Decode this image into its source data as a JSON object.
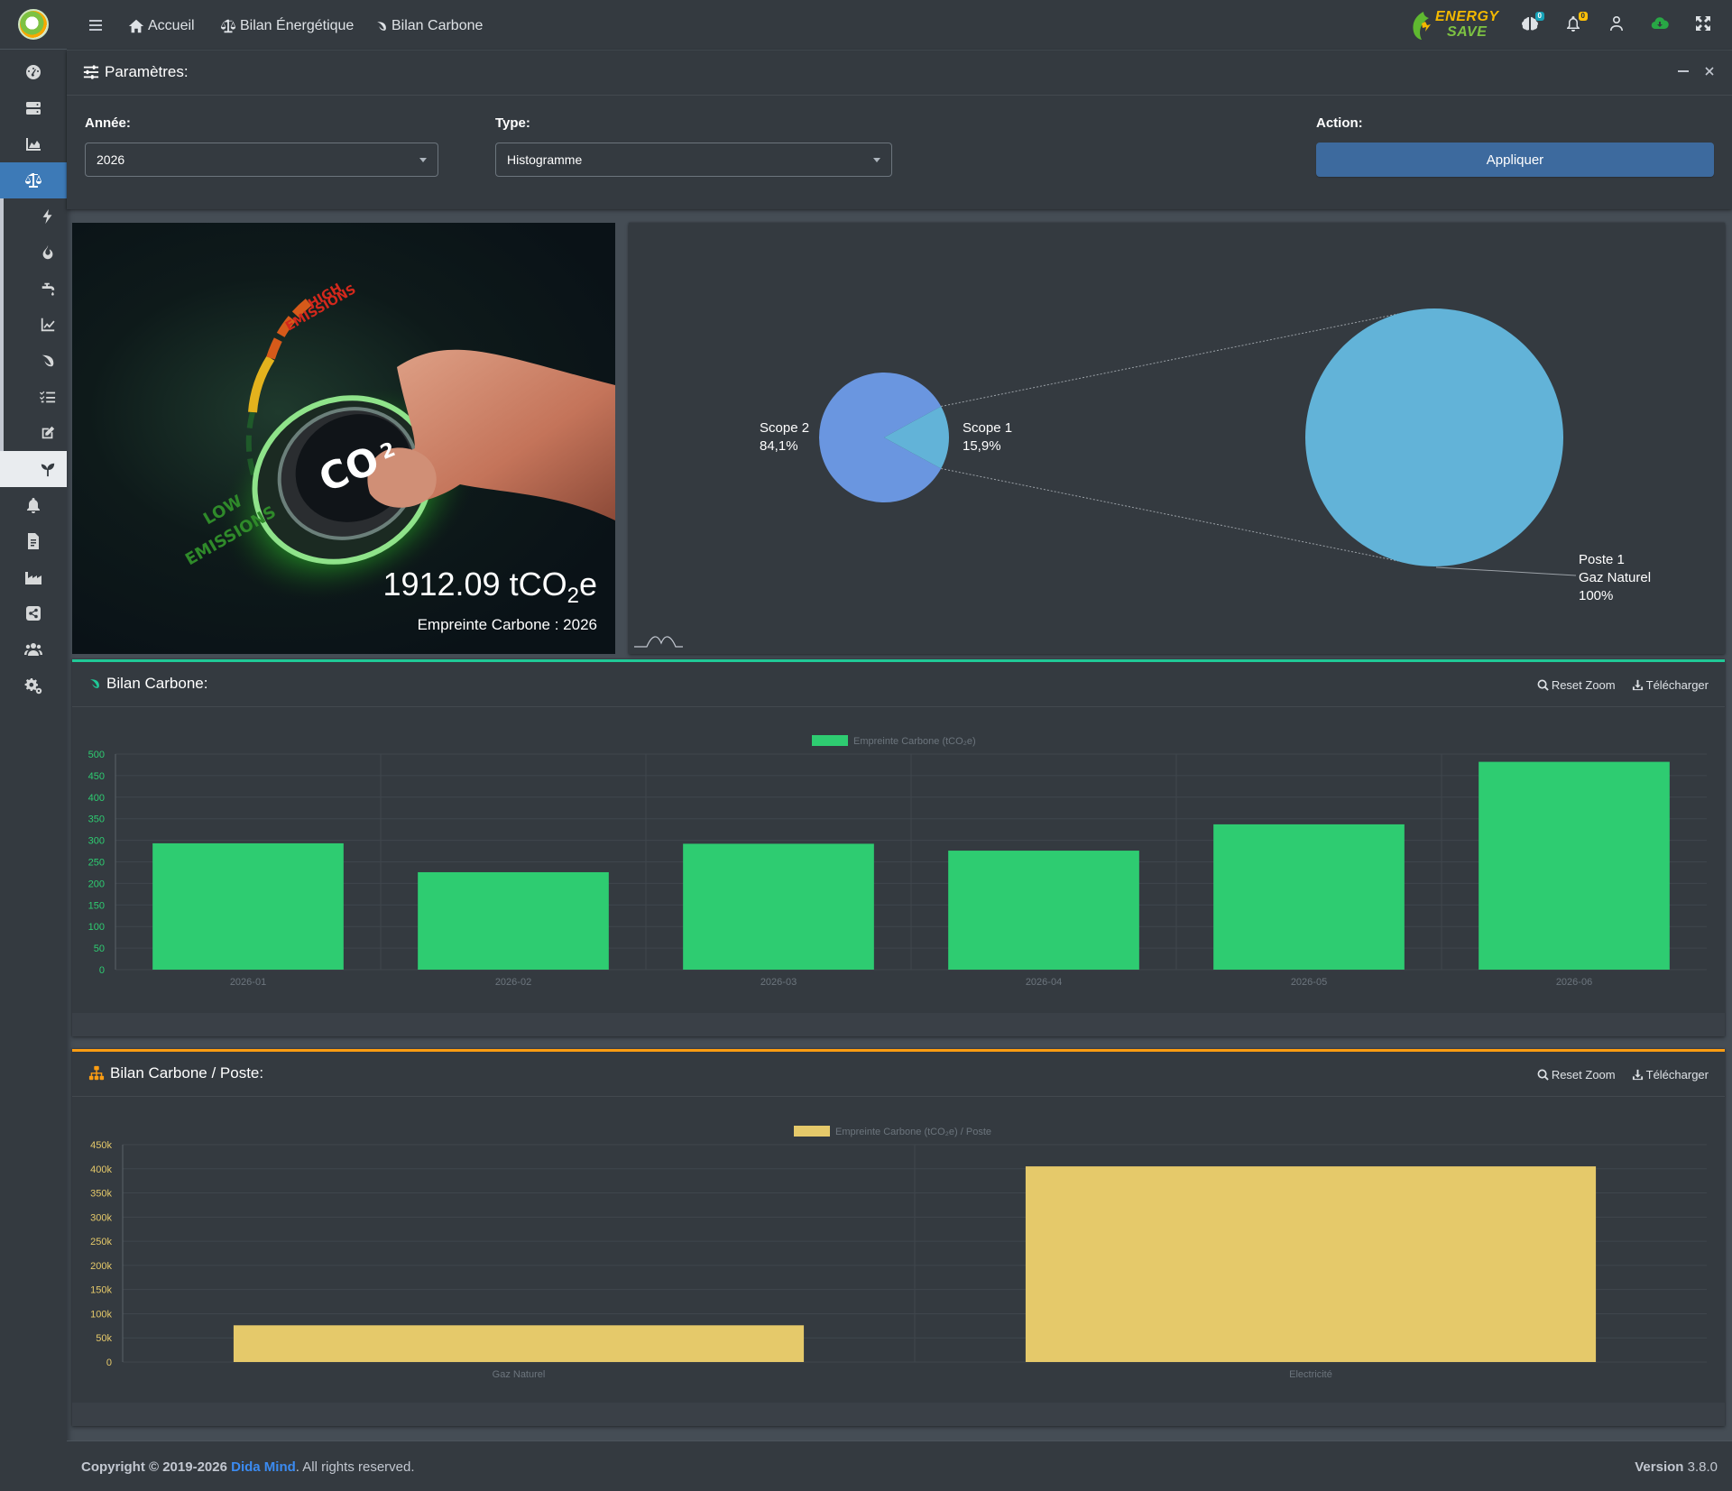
{
  "nav": {
    "home": "Accueil",
    "energy": "Bilan Énergétique",
    "carbon": "Bilan Carbone",
    "brand_line1": "ENERGY",
    "brand_line2": "SAVE",
    "badge_1": "0",
    "badge_2": "0"
  },
  "sidebar": {
    "icons": [
      "dashboard-icon",
      "server-icon",
      "area-chart-icon",
      "balance-scale-icon",
      "bolt-icon",
      "fire-icon",
      "faucet-icon",
      "line-chart-icon",
      "leaf-icon",
      "list-check-icon",
      "edit-icon",
      "seedling-icon",
      "bell-icon",
      "file-invoice-icon",
      "industry-icon",
      "share-icon",
      "users-icon",
      "cogs-icon"
    ]
  },
  "params": {
    "title": "Paramètres:",
    "year_label": "Année:",
    "year_value": "2026",
    "type_label": "Type:",
    "type_value": "Histogramme",
    "action_label": "Action:",
    "apply_label": "Appliquer"
  },
  "hero": {
    "high_line1": "HIGH",
    "high_line2": "EMISSIONS",
    "low_line1": "LOW",
    "low_line2": "EMISSIONS",
    "knob_text": "CO",
    "knob_sub": "2",
    "total_value": "1912.09",
    "unit_main": "tCO",
    "unit_sub": "2",
    "unit_end": "e",
    "caption": "Empreinte Carbone : 2026"
  },
  "pie": {
    "scope2_label": "Scope 2",
    "scope2_pct": "84,1%",
    "scope1_label": "Scope 1",
    "scope1_pct": "15,9%",
    "poste_line1": "Poste 1",
    "poste_line2": "Gaz Naturel",
    "poste_line3": "100%"
  },
  "colors": {
    "scope2": "#6a96e0",
    "scope1": "#62b3d8",
    "bar_green": "#2ecc71",
    "bar_yellow": "#e5c96a",
    "accent_green": "#20c997",
    "accent_orange": "#fd9d12"
  },
  "chart1": {
    "title": "Bilan Carbone:",
    "reset_zoom": "Reset Zoom",
    "download": "Télécharger",
    "legend": "Empreinte Carbone (tCO₂e)"
  },
  "chart2": {
    "title": "Bilan Carbone / Poste:",
    "reset_zoom": "Reset Zoom",
    "download": "Télécharger",
    "legend": "Empreinte Carbone (tCO₂e) / Poste"
  },
  "footer": {
    "copyright": "Copyright © 2019-2026 ",
    "company": "Dida Mind",
    "suffix": ". All rights reserved.",
    "version_label": "Version",
    "version_value": "3.8.0"
  },
  "chart_data": [
    {
      "type": "pie",
      "categories": [
        "Scope 2",
        "Scope 1"
      ],
      "values": [
        84.1,
        15.9
      ],
      "drilldown": {
        "categories": [
          "Poste 1 Gaz Naturel"
        ],
        "values": [
          100
        ]
      }
    },
    {
      "type": "bar",
      "categories": [
        "2026-01",
        "2026-02",
        "2026-03",
        "2026-04",
        "2026-05",
        "2026-06"
      ],
      "series": [
        {
          "name": "Empreinte Carbone (tCO₂e)",
          "values": [
            293,
            226,
            292,
            276,
            337,
            482
          ]
        }
      ],
      "ylim": [
        0,
        500
      ],
      "yticks": [
        0,
        50,
        100,
        150,
        200,
        250,
        300,
        350,
        400,
        450,
        500
      ],
      "legend": "top"
    },
    {
      "type": "bar",
      "categories": [
        "Gaz Naturel",
        "Electricité"
      ],
      "series": [
        {
          "name": "Empreinte Carbone (tCO₂e) / Poste",
          "values": [
            76000,
            405000
          ]
        }
      ],
      "ylim": [
        0,
        450000
      ],
      "ytick_labels": [
        "0",
        "50k",
        "100k",
        "150k",
        "200k",
        "250k",
        "300k",
        "350k",
        "400k",
        "450k"
      ],
      "legend": "top"
    }
  ]
}
